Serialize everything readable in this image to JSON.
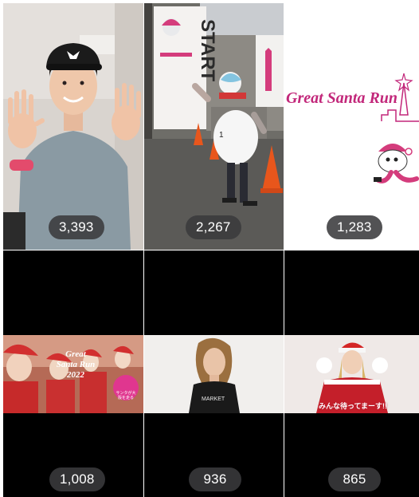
{
  "reels": [
    {
      "id": "reel-1",
      "count": "3,393",
      "overlay_text": "",
      "description": "man in cap waving both hands"
    },
    {
      "id": "reel-2",
      "count": "2,267",
      "overlay_text": "START",
      "description": "person in snowman costume at start gate"
    },
    {
      "id": "reel-3",
      "count": "1,283",
      "overlay_text": "Great Santa Run",
      "description": "Great Santa Run logo with santa mascot"
    },
    {
      "id": "reel-4",
      "count": "1,008",
      "overlay_text": "Great Santa Run 2022",
      "badge_text": "サンタが大阪を走る",
      "description": "runners in santa costumes"
    },
    {
      "id": "reel-5",
      "count": "936",
      "overlay_text": "",
      "description": "woman in black top"
    },
    {
      "id": "reel-6",
      "count": "865",
      "overlay_text": "みんな待ってまーす!!",
      "description": "woman in santa costume waving"
    }
  ],
  "icons": {
    "play": "play-icon"
  },
  "colors": {
    "badge_bg": "#3a3a3c",
    "brand_pink": "#c2277a",
    "tile_black": "#000000"
  }
}
